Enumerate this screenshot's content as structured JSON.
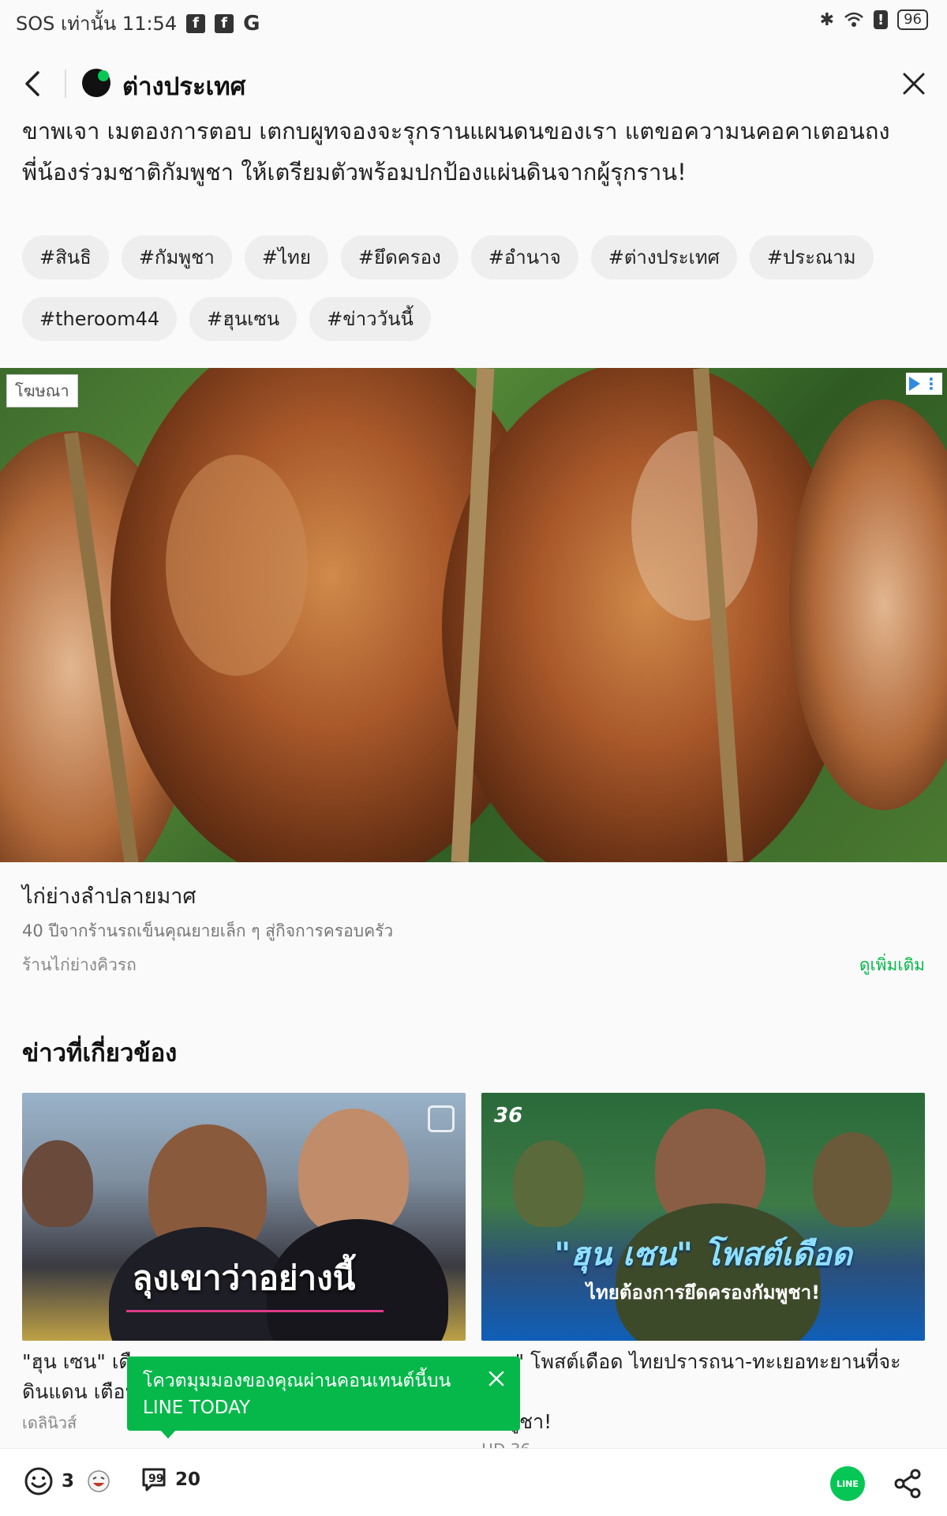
{
  "status_bar": {
    "left_text": "SOS เท่านั้น 11:54",
    "icons": [
      "facebook-icon",
      "facebook-icon",
      "google-icon"
    ],
    "battery": "96"
  },
  "header": {
    "title": "ต่างประเทศ"
  },
  "article": {
    "line1": "ขาพเจา เมตองการตอบ เตกบผูทจองจะรุกรานแผนดนของเรา แตขอความนคอคาเตอนถง",
    "line2": "พี่น้องร่วมชาติกัมพูชา ให้เตรียมตัวพร้อมปกป้องแผ่นดินจากผู้รุกราน!"
  },
  "tags": [
    "#สินธิ",
    "#กัมพูชา",
    "#ไทย",
    "#ยึดครอง",
    "#อำนาจ",
    "#ต่างประเทศ",
    "#ประณาม",
    "#theroom44",
    "#ฮุนเซน",
    "#ข่าววันนี้"
  ],
  "ad": {
    "label": "โฆษณา",
    "title": "ไก่ย่างลำปลายมาศ",
    "description": "40 ปีจากร้านรถเข็นคุณยายเล็ก ๆ สู่กิจการครอบครัว",
    "source": "ร้านไก่ย่างคิวรถ",
    "more_label": "ดูเพิ่มเติม"
  },
  "related": {
    "title": "ข่าวที่เกี่ยวข้อง",
    "items": [
      {
        "overlay": "ลุงเขาว่าอย่างนี้",
        "text_line1": "\"ฮุน เซน\" เดือ",
        "text_line2": "ดินแดน เตือน",
        "source": "เดลินิวส์"
      },
      {
        "logo": "36",
        "overlay_line1": "\"ฮุน เซน\" โพสต์เดือด",
        "overlay_line2": "ไทยต้องการยึดครองกัมพูชา!",
        "text_line1": "เซน\" โพสต์เดือด ไทยปรารถนา-ทะเยอทะยานที่จะยึด",
        "text_line2": "กัมพูชา!",
        "source": "HD 36"
      }
    ]
  },
  "tooltip": {
    "text": "โควตมุมมองของคุณผ่านคอนเทนต์นี้บน LINE TODAY"
  },
  "bottom_bar": {
    "reactions_count": "3",
    "comments_count": "20",
    "line_label": "LINE"
  },
  "colors": {
    "accent": "#06b84a",
    "line_green": "#06c755",
    "tag_bg": "#eeeeee"
  }
}
